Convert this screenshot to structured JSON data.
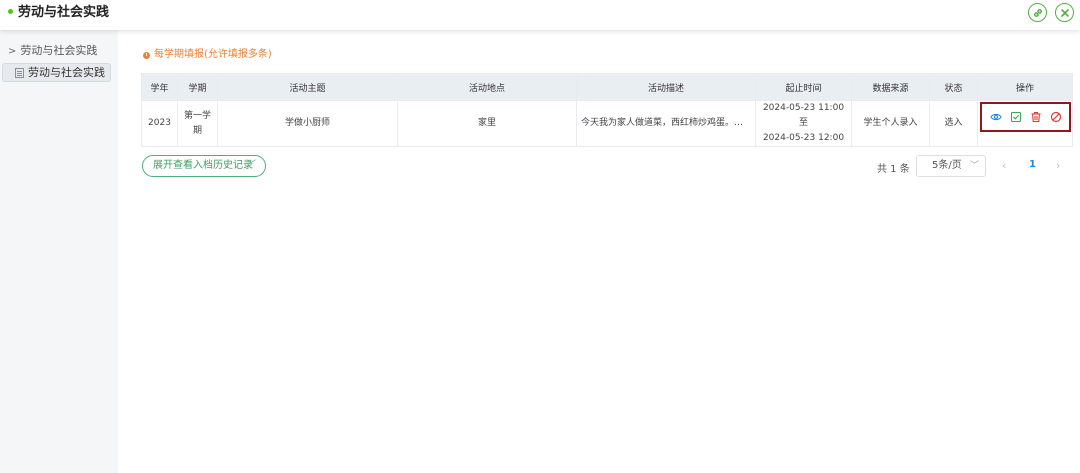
{
  "header": {
    "title": "劳动与社会实践",
    "link_icon": "link-icon",
    "close_icon": "close-circle-icon"
  },
  "sidebar": {
    "parent": {
      "caret": ">",
      "label": "劳动与社会实践"
    },
    "child": {
      "label": "劳动与社会实践",
      "icon": "document-icon"
    }
  },
  "notice": "每学期填报(允许填报多条)",
  "table": {
    "headers": [
      "学年",
      "学期",
      "活动主题",
      "活动地点",
      "活动描述",
      "起止时间",
      "数据来源",
      "状态",
      "操作"
    ],
    "rows": [
      {
        "year": "2023",
        "term": "第一学期",
        "theme": "学做小厨师",
        "location": "家里",
        "description": "今天我为家人做道菜，西红柿炒鸡蛋。首先...",
        "time_start": "2024-05-23 11:00 至",
        "time_end": "2024-05-23 12:00",
        "source": "学生个人录入",
        "status": "选入",
        "ops": [
          "view-icon",
          "edit-check-icon",
          "delete-icon",
          "disable-icon"
        ]
      }
    ]
  },
  "expand_button": {
    "label": "展开查看入档历史记录",
    "chevron": "﹀"
  },
  "pagination": {
    "total": "共 1 条",
    "page_size": "5条/页",
    "prev": "‹",
    "current": "1",
    "next": "›"
  },
  "colors": {
    "accent_green": "#52b043",
    "notice_orange": "#e8823a",
    "page_blue": "#1e88e5",
    "highlight_border": "#8b1a1a"
  }
}
